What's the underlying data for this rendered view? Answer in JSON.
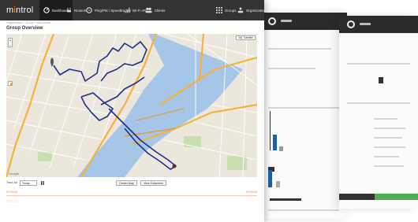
{
  "app": {
    "logo_prefix": "m",
    "logo_accent": "i",
    "logo_suffix": "ntrol",
    "accent_color": "#f08a24"
  },
  "nav": {
    "items": [
      {
        "label": "Dashboard",
        "icon": "dashboard-icon"
      },
      {
        "label": "Routers",
        "icon": "router-icon"
      },
      {
        "label": "Ping/PM / Speedtracker",
        "icon": "gauge-icon"
      },
      {
        "label": "Wi-Fi AP",
        "icon": "signal-bars-icon"
      },
      {
        "label": "Clients",
        "icon": "users-icon"
      }
    ],
    "right_items": [
      {
        "label": "Groups",
        "icon": "grid-icon"
      },
      {
        "label": "Organization",
        "icon": "organization-icon"
      }
    ]
  },
  "breadcrumb": "Organization > Group > Dashboard",
  "page": {
    "title": "Group Overview"
  },
  "map": {
    "type_buttons": [
      "Map",
      "Satellite"
    ],
    "zoom_plus": "+",
    "zoom_minus": "−",
    "attribution": "Google",
    "route_color": "#1e2f8c"
  },
  "controls": {
    "track_label": "Track for",
    "period_value": "Today",
    "pause_icon": "pause-icon",
    "center_map_label": "Center Map",
    "fullscreen_label": "View Fullscreen"
  },
  "timeline": [
    {
      "start": "00:00:00",
      "end": "00:00:00",
      "color": "#e8743b"
    },
    {
      "start": "00:00:00",
      "end": "",
      "color": "#e8743b"
    }
  ]
}
